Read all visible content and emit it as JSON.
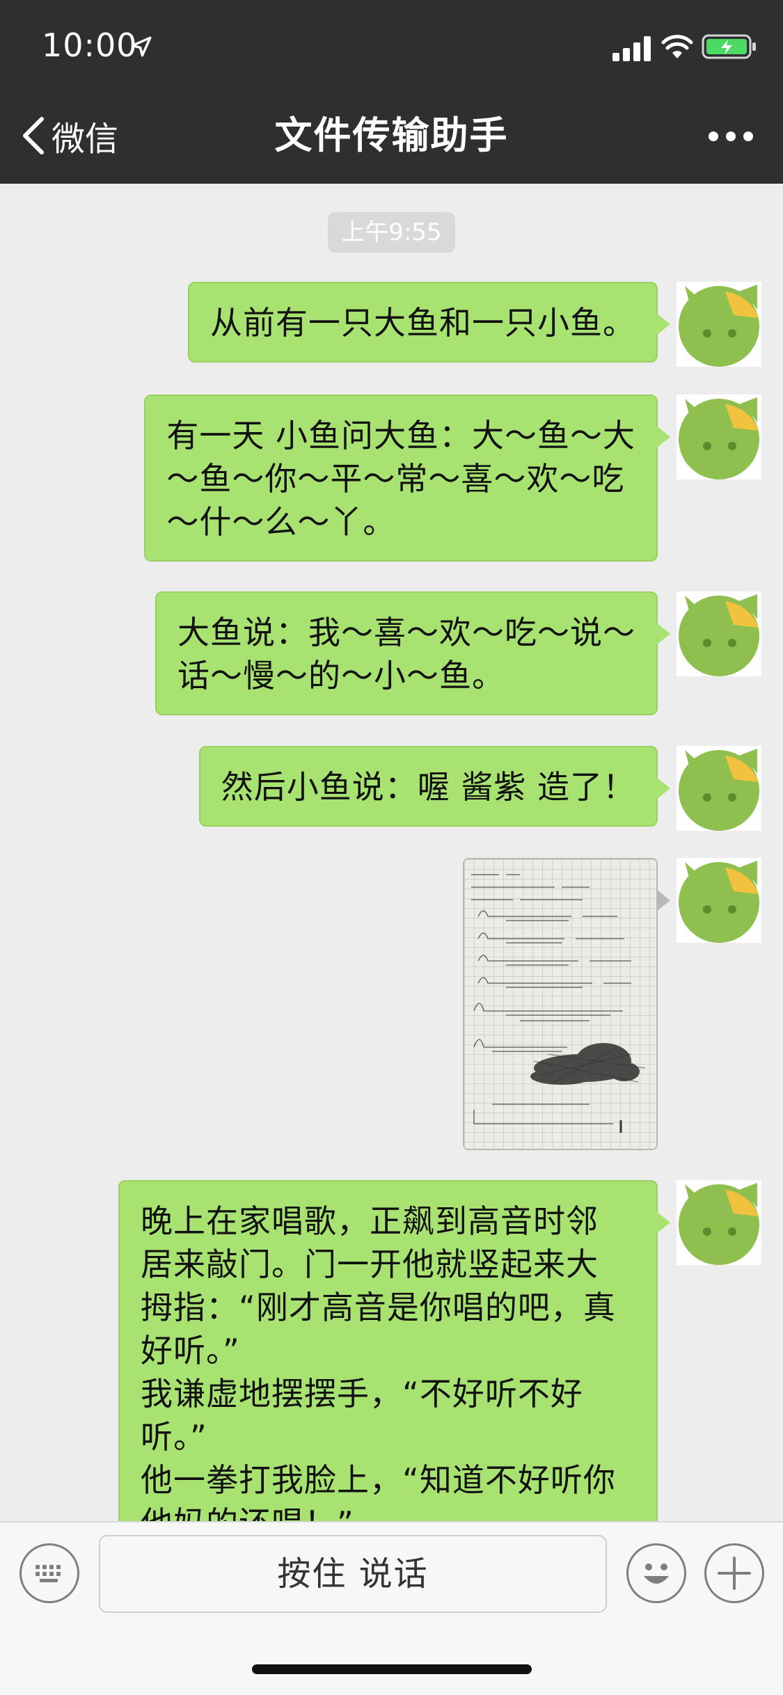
{
  "status_bar": {
    "time": "10:00",
    "icons": [
      "location-arrow-icon",
      "signal-bars-icon",
      "wifi-icon",
      "battery-charging-icon"
    ],
    "battery_color": "#4cd964"
  },
  "nav": {
    "back_label": "微信",
    "title": "文件传输助手",
    "more_icon": "more-dots-icon"
  },
  "chat": {
    "timestamp": "上午9:55",
    "bubble_color": "#a8e372",
    "messages": [
      {
        "type": "text",
        "text": "从前有一只大鱼和一只小鱼。"
      },
      {
        "type": "text",
        "text": "有一天 小鱼问大鱼：大～鱼～大\n～鱼～你～平～常～喜～欢～吃\n～什～么～丫。"
      },
      {
        "type": "text",
        "text": "大鱼说：我～喜～欢～吃～说～\n话～慢～的～小～鱼。"
      },
      {
        "type": "text",
        "text": "然后小鱼说：喔 酱紫 造了！"
      },
      {
        "type": "image",
        "description": "handwritten-math-notes-photo"
      },
      {
        "type": "text",
        "text": "晚上在家唱歌，正飙到高音时邻\n居来敲门。门一开他就竖起来大\n拇指：“刚才高音是你唱的吧，真\n好听。”\n我谦虚地摆摆手，“不好听不好\n听。”\n他一拳打我脸上，“知道不好听你\n他妈的还唱！”"
      }
    ]
  },
  "input_bar": {
    "hold_to_talk": "按住 说话",
    "left_icon": "keyboard-icon",
    "emoji_icon": "emoji-icon",
    "plus_icon": "plus-icon"
  }
}
